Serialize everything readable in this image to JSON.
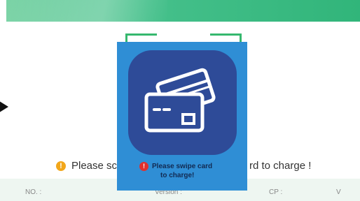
{
  "background_message": {
    "part1": "Please sca",
    "part2": "rd to charge !"
  },
  "modal": {
    "message_line1": "Please swipe card",
    "message_line2": "to charge!",
    "icon": "card-icon"
  },
  "footer": {
    "no_label": "NO. :",
    "version_label": "Version :",
    "cp_label": "CP :",
    "v_label": "V"
  },
  "colors": {
    "header_green": "#31b57a",
    "modal_blue": "#2f8ed5",
    "icon_bg": "#2e4b98",
    "warning": "#f2a71b",
    "error": "#e0302e"
  }
}
